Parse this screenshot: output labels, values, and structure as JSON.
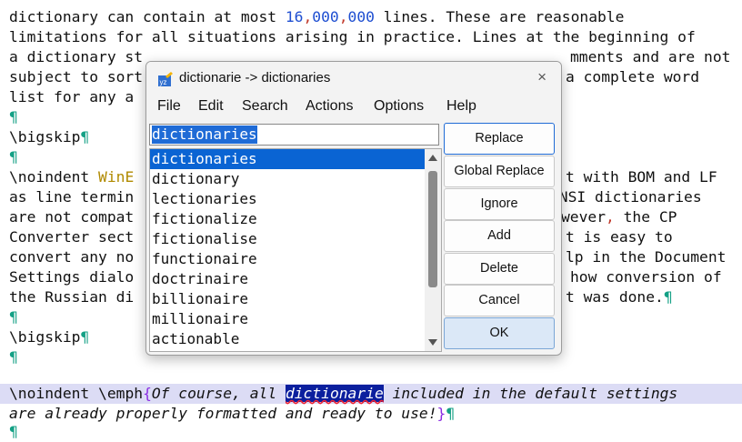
{
  "editor": {
    "line1": {
      "a": "dictionary can contain at most ",
      "n1": "16",
      "c1": ",",
      "n2": "000",
      "c2": ",",
      "n3": "000",
      "b": " lines. These are reasonable"
    },
    "line2": "limitations for all situations arising in practice. Lines at the beginning of",
    "line3_left": "a dictionary st",
    "line3_right": "mments and are not",
    "line4_left": "subject to sort",
    "line4_right": "a complete word",
    "line5_left": "list for any a",
    "pilcrow": "¶",
    "bigskip": "\\bigskip",
    "noindent": "\\noindent",
    "wine_fragment": "WinE",
    "line8_right": "t with BOM and LF",
    "line9_left": "as line termin",
    "line9_right": "ANSI dictionaries",
    "line10_left": "are not compat",
    "line10_right_a": "wever",
    "line10_right_comma": ",",
    "line10_right_b": " the CP",
    "line11_left": "Converter sect",
    "line11_right": "t is easy to",
    "line12_left": "convert any no",
    "line12_right": "lp in the Document",
    "line13_left": "Settings dialo",
    "line13_right": "how conversion of",
    "line14_left": "the Russian di",
    "line14_right": "t was done.",
    "emph_cmd": "\\emph",
    "brace_open": "{",
    "emph_a": "Of course",
    "emph_comma": ",",
    "emph_b": " all ",
    "emph_selected": "dictionarie",
    "emph_c": " included in the default settings",
    "line19_a": "are already properly formatted and ready to use",
    "line19_excl": "!",
    "brace_close": "}"
  },
  "dialog": {
    "title": "dictionarie -> dictionaries",
    "close_glyph": "×",
    "menu": [
      "File",
      "Edit",
      "Search",
      "Actions",
      "Options",
      "Help"
    ],
    "word_value": "dictionaries",
    "suggestions": [
      "dictionaries",
      "dictionary",
      "lectionaries",
      "fictionalize",
      "fictionalise",
      "functionaire",
      "doctrinaire",
      "billionaire",
      "millionaire",
      "actionable"
    ],
    "selected_index": 0,
    "buttons": {
      "replace": "Replace",
      "global_replace": "Global Replace",
      "ignore": "Ignore",
      "add": "Add",
      "delete": "Delete",
      "cancel": "Cancel",
      "ok": "OK"
    },
    "icon": "spellcheck-icon"
  },
  "colors": {
    "number": "#1f4fd1",
    "comma": "#c0392b",
    "pilcrow": "#14a085",
    "selection": "#0a64d3",
    "highlighted_line": "#dcdcf5"
  }
}
